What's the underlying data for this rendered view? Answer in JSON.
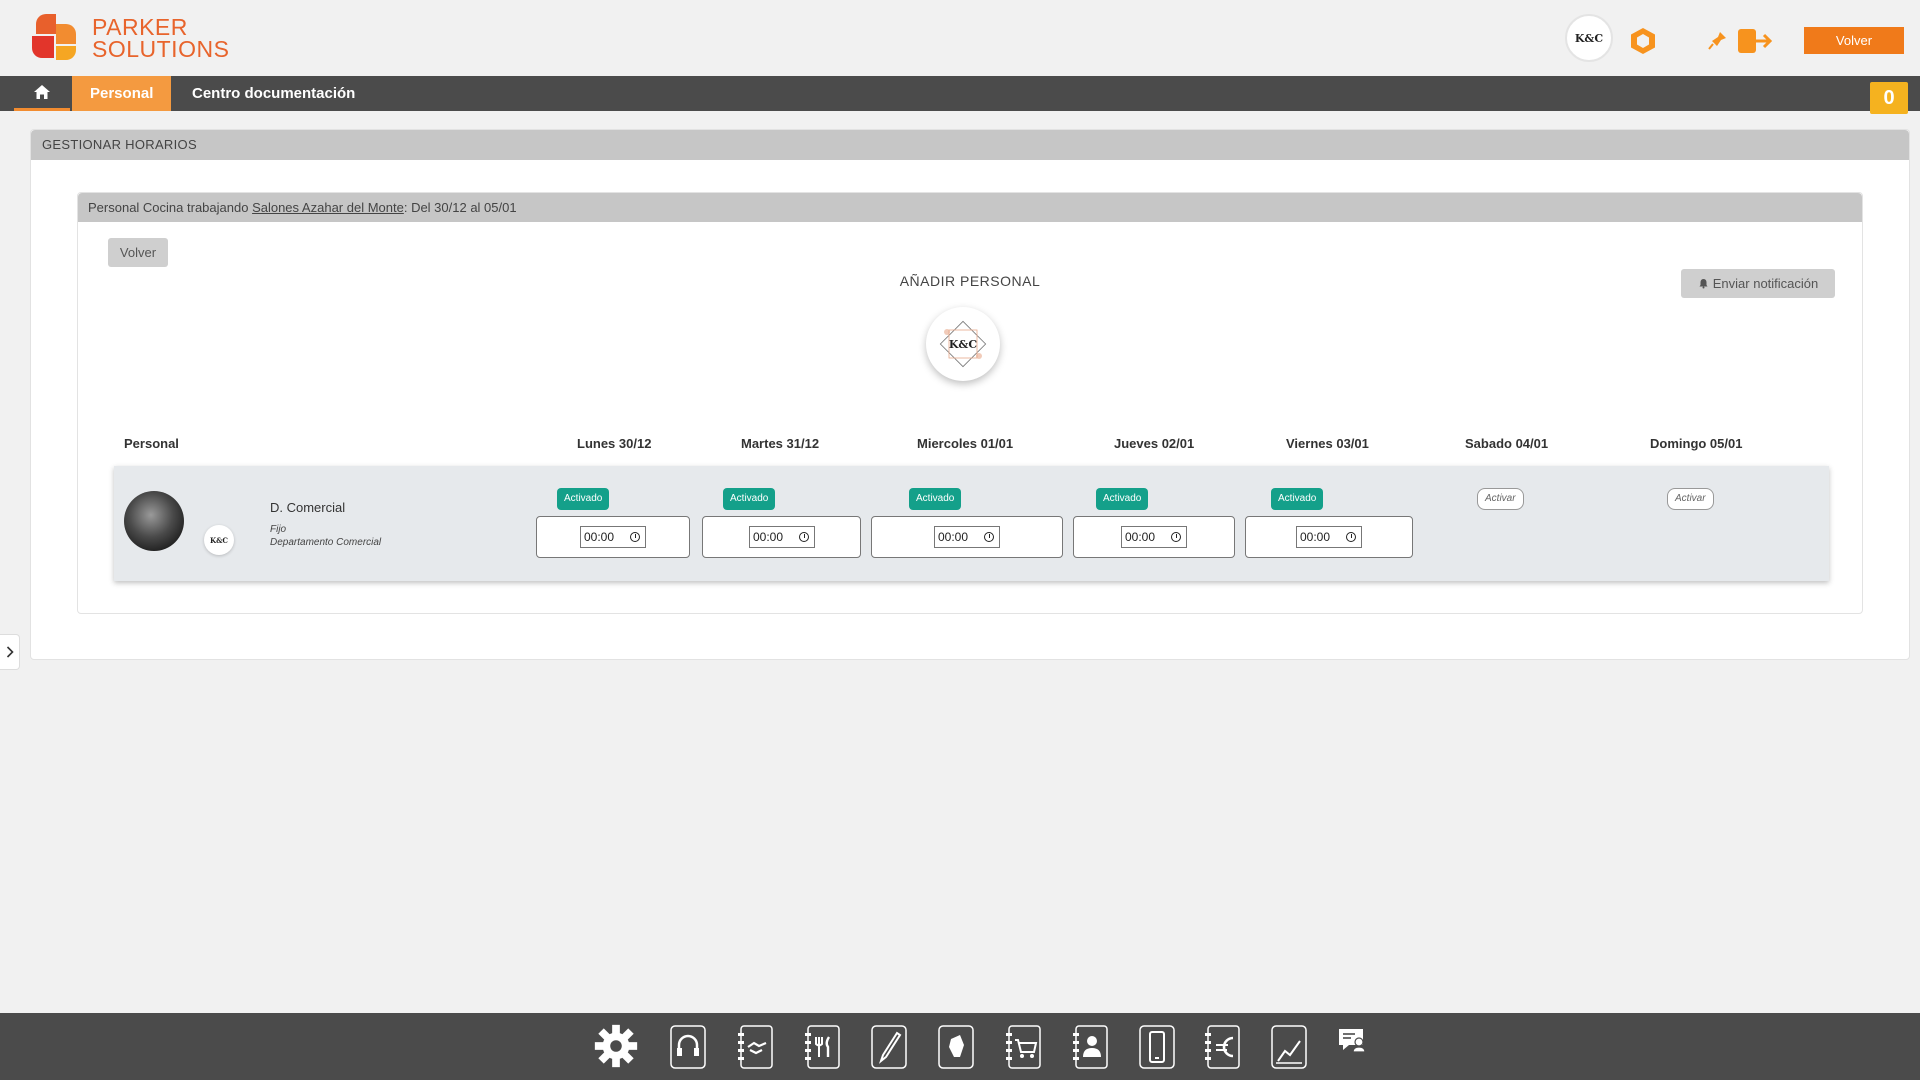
{
  "brand": {
    "line1": "PARKER",
    "line2": "SOLUTIONS",
    "color": "#e8642c"
  },
  "header": {
    "avatar_text": "K&C",
    "volver_label": "Volver"
  },
  "nav": {
    "home_icon": "home-icon",
    "tabs": [
      {
        "label": "Personal",
        "active": true
      },
      {
        "label": "Centro documentación",
        "active": false
      }
    ],
    "cart_count": "0"
  },
  "panel": {
    "title": "GESTIONAR HORARIOS"
  },
  "card": {
    "title_prefix": "Personal Cocina trabajando ",
    "title_link": "Salones Azahar del Monte",
    "title_suffix": ": Del 30/12 al 05/01",
    "volver_label": "Volver",
    "add_title": "AÑADIR PERSONAL",
    "add_avatar_text": "K&C",
    "notif_label": "Enviar notificación"
  },
  "table": {
    "personal_header": "Personal",
    "days": [
      {
        "label": "Lunes 30/12",
        "status": "Activado",
        "active": true,
        "time": "00:00"
      },
      {
        "label": "Martes 31/12",
        "status": "Activado",
        "active": true,
        "time": "00:00"
      },
      {
        "label": "Miercoles 01/01",
        "status": "Activado",
        "active": true,
        "time": "00:00"
      },
      {
        "label": "Jueves 02/01",
        "status": "Activado",
        "active": true,
        "time": "00:00"
      },
      {
        "label": "Viernes 03/01",
        "status": "Activado",
        "active": true,
        "time": "00:00"
      },
      {
        "label": "Sabado 04/01",
        "status": "Activar",
        "active": false,
        "time": ""
      },
      {
        "label": "Domingo 05/01",
        "status": "Activar",
        "active": false,
        "time": ""
      }
    ],
    "row": {
      "name": "D. Comercial",
      "type": "Fijo",
      "department": "Departamento Comercial",
      "logo_text": "K&C"
    }
  },
  "colors": {
    "accent": "#f07a1a",
    "nav_bg": "#4b4b4b",
    "active_badge": "#14a08a",
    "tab_active": "#f49a40"
  },
  "dock": [
    "gear-icon",
    "headset-icon",
    "handshake-icon",
    "cutlery-icon",
    "pencil-icon",
    "hand-icon",
    "cart-icon",
    "contacts-icon",
    "mobile-icon",
    "euro-icon",
    "chart-icon",
    "chat-user-icon"
  ]
}
